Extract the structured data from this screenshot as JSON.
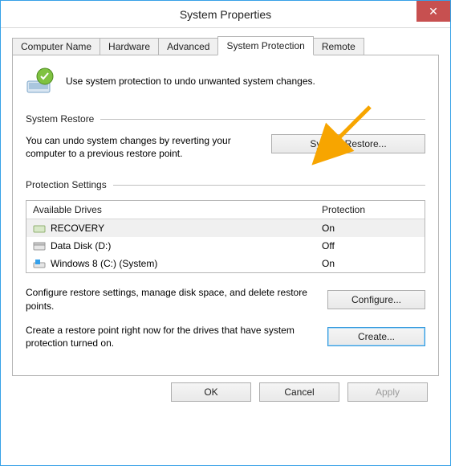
{
  "window": {
    "title": "System Properties"
  },
  "tabs": {
    "items": [
      {
        "label": "Computer Name",
        "active": false
      },
      {
        "label": "Hardware",
        "active": false
      },
      {
        "label": "Advanced",
        "active": false
      },
      {
        "label": "System Protection",
        "active": true
      },
      {
        "label": "Remote",
        "active": false
      }
    ]
  },
  "intro": {
    "text": "Use system protection to undo unwanted system changes."
  },
  "restore": {
    "heading": "System Restore",
    "description": "You can undo system changes by reverting your computer to a previous restore point.",
    "button": "System Restore..."
  },
  "protection": {
    "heading": "Protection Settings",
    "columns": {
      "drive": "Available Drives",
      "status": "Protection"
    },
    "drives": [
      {
        "name": "RECOVERY",
        "status": "On",
        "icon": "drive-recovery"
      },
      {
        "name": "Data Disk (D:)",
        "status": "Off",
        "icon": "drive-disk"
      },
      {
        "name": "Windows 8 (C:) (System)",
        "status": "On",
        "icon": "drive-windows"
      }
    ],
    "configure": {
      "description": "Configure restore settings, manage disk space, and delete restore points.",
      "button": "Configure..."
    },
    "create": {
      "description": "Create a restore point right now for the drives that have system protection turned on.",
      "button": "Create..."
    }
  },
  "footer": {
    "ok": "OK",
    "cancel": "Cancel",
    "apply": "Apply"
  }
}
